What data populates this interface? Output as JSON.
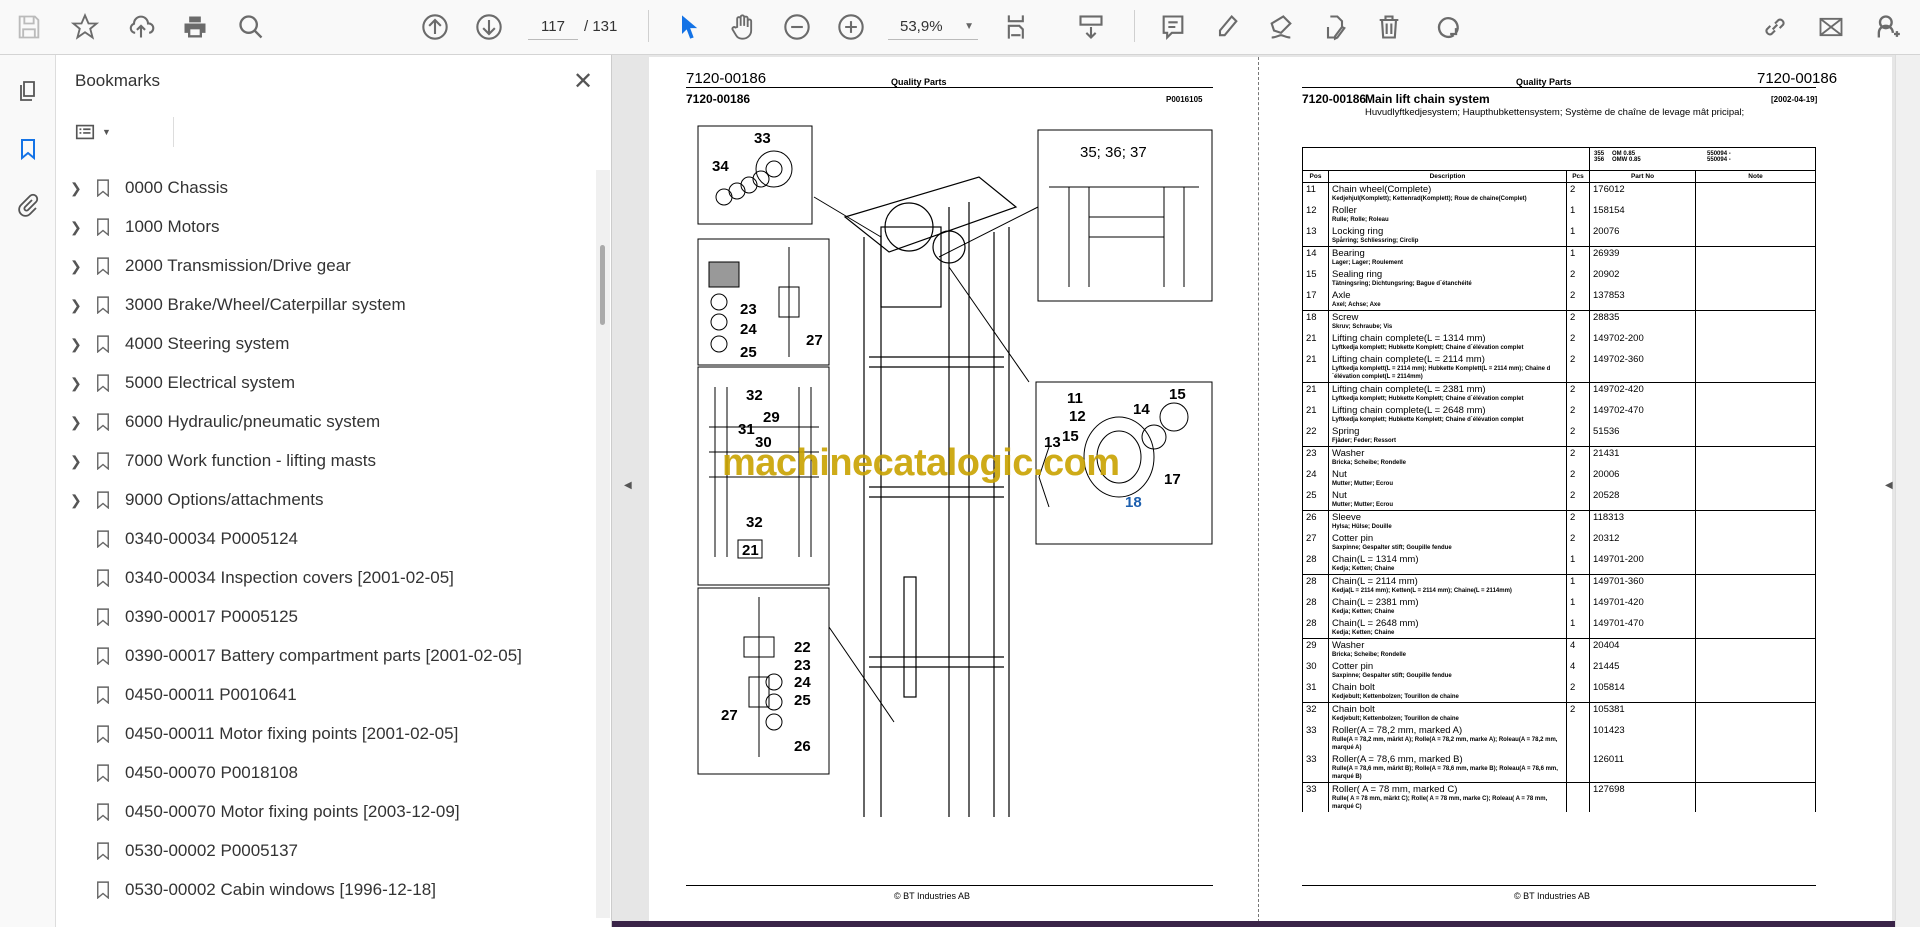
{
  "toolbar": {
    "page_current": "117",
    "page_total": "/ 131",
    "zoom": "53,9%"
  },
  "bookmarks": {
    "title": "Bookmarks",
    "items": [
      {
        "label": "0000 Chassis",
        "expandable": true
      },
      {
        "label": "1000 Motors",
        "expandable": true
      },
      {
        "label": "2000 Transmission/Drive gear",
        "expandable": true
      },
      {
        "label": "3000 Brake/Wheel/Caterpillar system",
        "expandable": true
      },
      {
        "label": "4000 Steering system",
        "expandable": true
      },
      {
        "label": "5000 Electrical system",
        "expandable": true
      },
      {
        "label": "6000 Hydraulic/pneumatic system",
        "expandable": true
      },
      {
        "label": "7000 Work function - lifting masts",
        "expandable": true
      },
      {
        "label": "9000 Options/attachments",
        "expandable": true
      },
      {
        "label": "0340-00034 P0005124",
        "expandable": false
      },
      {
        "label": "0340-00034 Inspection covers [2001-02-05]",
        "expandable": false
      },
      {
        "label": "0390-00017 P0005125",
        "expandable": false
      },
      {
        "label": "0390-00017 Battery compartment parts [2001-02-05]",
        "expandable": false
      },
      {
        "label": "0450-00011 P0010641",
        "expandable": false
      },
      {
        "label": "0450-00011 Motor fixing points [2001-02-05]",
        "expandable": false
      },
      {
        "label": "0450-00070 P0018108",
        "expandable": false
      },
      {
        "label": "0450-00070 Motor fixing points [2003-12-09]",
        "expandable": false
      },
      {
        "label": "0530-00002 P0005137",
        "expandable": false
      },
      {
        "label": "0530-00002 Cabin windows [1996-12-18]",
        "expandable": false
      }
    ]
  },
  "left_page": {
    "code": "7120-00186",
    "header": "Quality Parts",
    "subcode": "7120-00186",
    "figure_id": "P0016105",
    "footer": "© BT Industries AB",
    "callouts": {
      "a": "33",
      "b": "34",
      "c": "35; 36; 37",
      "d": "23",
      "e": "24",
      "f": "25",
      "g": "27",
      "h": "32",
      "i": "29",
      "j": "31",
      "k": "30",
      "l": "32",
      "m": "21",
      "n": "22",
      "o": "23",
      "p": "24",
      "q": "25",
      "r": "27",
      "s": "26",
      "t": "11",
      "u": "12",
      "v": "13",
      "w": "15",
      "x": "15",
      "y": "14",
      "z": "17",
      "aa": "18"
    },
    "watermark": "machinecatalogic.com"
  },
  "right_page": {
    "header": "Quality Parts",
    "code": "7120-00186",
    "section_code": "7120-00186",
    "section_title": "Main lift chain system",
    "date": "[2002-04-19]",
    "translations": "Huvudlyftkedjesystem; Haupthubkettensystem; Système de chaîne de levage mât pricipal;",
    "models": [
      {
        "num": "355",
        "name": "OM 0.85",
        "serial": "550094 -"
      },
      {
        "num": "356",
        "name": "OMW 0.85",
        "serial": "550094 -"
      }
    ],
    "columns": [
      "Pos",
      "Description",
      "Pcs",
      "Part No",
      "Note"
    ],
    "rows": [
      {
        "pos": "11",
        "desc": "Chain wheel(Complete)",
        "sub": "Kedjehjul(Komplett); Kettenrad(Komplett); Roue de chaine(Complet)",
        "pcs": "2",
        "part": "176012",
        "sep": true
      },
      {
        "pos": "12",
        "desc": "Roller",
        "sub": "Rulle; Rolle; Roleau",
        "pcs": "1",
        "part": "158154"
      },
      {
        "pos": "13",
        "desc": "Locking ring",
        "sub": "Spårring; Schliessring; Circlip",
        "pcs": "1",
        "part": "20076"
      },
      {
        "pos": "14",
        "desc": "Bearing",
        "sub": "Lager; Lager; Roulement",
        "pcs": "1",
        "part": "26939",
        "sep": true
      },
      {
        "pos": "15",
        "desc": "Sealing ring",
        "sub": "Tätningsring; Dichtungsring; Bague d´étanchéité",
        "pcs": "2",
        "part": "20902"
      },
      {
        "pos": "17",
        "desc": "Axle",
        "sub": "Axel; Achse; Axe",
        "pcs": "2",
        "part": "137853"
      },
      {
        "pos": "18",
        "desc": "Screw",
        "sub": "Skruv; Schraube; Vis",
        "pcs": "2",
        "part": "28835",
        "sep": true
      },
      {
        "pos": "21",
        "desc": "Lifting chain complete(L = 1314 mm)",
        "sub": "Lyftkedja komplett; Hubkette Komplett; Chaine d´élévation complet",
        "pcs": "2",
        "part": "149702-200"
      },
      {
        "pos": "21",
        "desc": "Lifting chain complete(L = 2114 mm)",
        "sub": "Lyftkedja komplett(L = 2114 mm); Hubkette Komplett(L = 2114 mm); Chaine d´élévation complet(L = 2114mm)",
        "pcs": "2",
        "part": "149702-360"
      },
      {
        "pos": "21",
        "desc": "Lifting chain complete(L = 2381 mm)",
        "sub": "Lyftkedja komplett; Hubkette Komplett; Chaine d´élévation complet",
        "pcs": "2",
        "part": "149702-420",
        "sep": true
      },
      {
        "pos": "21",
        "desc": "Lifting chain complete(L = 2648 mm)",
        "sub": "Lyftkedja komplett; Hubkette Komplett; Chaine d´élévation complet",
        "pcs": "2",
        "part": "149702-470"
      },
      {
        "pos": "22",
        "desc": "Spring",
        "sub": "Fjäder; Feder; Ressort",
        "pcs": "2",
        "part": "51536"
      },
      {
        "pos": "23",
        "desc": "Washer",
        "sub": "Bricka; Scheibe; Rondelle",
        "pcs": "2",
        "part": "21431",
        "sep": true
      },
      {
        "pos": "24",
        "desc": "Nut",
        "sub": "Mutter; Mutter; Ecrou",
        "pcs": "2",
        "part": "20006"
      },
      {
        "pos": "25",
        "desc": "Nut",
        "sub": "Mutter; Mutter; Ecrou",
        "pcs": "2",
        "part": "20528"
      },
      {
        "pos": "26",
        "desc": "Sleeve",
        "sub": "Hylsa; Hülse; Douille",
        "pcs": "2",
        "part": "118313",
        "sep": true
      },
      {
        "pos": "27",
        "desc": "Cotter pin",
        "sub": "Saxpinne; Gespalter stift; Goupille fendue",
        "pcs": "2",
        "part": "20312"
      },
      {
        "pos": "28",
        "desc": "Chain(L = 1314 mm)",
        "sub": "Kedja; Ketten; Chaine",
        "pcs": "1",
        "part": "149701-200"
      },
      {
        "pos": "28",
        "desc": "Chain(L = 2114 mm)",
        "sub": "Kedja(L = 2114 mm); Ketten(L = 2114 mm); Chaine(L = 2114mm)",
        "pcs": "1",
        "part": "149701-360",
        "sep": true
      },
      {
        "pos": "28",
        "desc": "Chain(L = 2381 mm)",
        "sub": "Kedja; Ketten; Chaine",
        "pcs": "1",
        "part": "149701-420"
      },
      {
        "pos": "28",
        "desc": "Chain(L = 2648 mm)",
        "sub": "Kedja; Ketten; Chaine",
        "pcs": "1",
        "part": "149701-470"
      },
      {
        "pos": "29",
        "desc": "Washer",
        "sub": "Bricka; Scheibe; Rondelle",
        "pcs": "4",
        "part": "20404",
        "sep": true
      },
      {
        "pos": "30",
        "desc": "Cotter pin",
        "sub": "Saxpinne; Gespalter stift; Goupille fendue",
        "pcs": "4",
        "part": "21445"
      },
      {
        "pos": "31",
        "desc": "Chain bolt",
        "sub": "Kedjebult; Kettenbolzen; Tourillon de chaine",
        "pcs": "2",
        "part": "105814"
      },
      {
        "pos": "32",
        "desc": "Chain bolt",
        "sub": "Kedjebult; Kettenbolzen; Tourillon de chaine",
        "pcs": "2",
        "part": "105381",
        "sep": true
      },
      {
        "pos": "33",
        "desc": "Roller(A = 78,2 mm,  marked A)",
        "sub": "Rulle(A = 78,2 mm,  märkt A); Rolle(A = 78,2 mm,  marke A); Roleau(A = 78,2 mm,  marqué A)",
        "pcs": "",
        "part": "101423"
      },
      {
        "pos": "33",
        "desc": "Roller(A = 78,6 mm,  marked B)",
        "sub": "Rulle(A = 78,6 mm,  märkt B); Rolle(A = 78,6 mm,  marke B); Roleau(A = 78,6 mm,  marqué B)",
        "pcs": "",
        "part": "126011"
      },
      {
        "pos": "33",
        "desc": "Roller( A = 78 mm,  marked C)",
        "sub": "Rulle( A = 78 mm,  märkt C); Rolle( A = 78 mm,  marke C); Roleau( A = 78 mm, marqué C)",
        "pcs": "",
        "part": "127698",
        "sep": true
      }
    ],
    "footer": "© BT Industries AB"
  }
}
